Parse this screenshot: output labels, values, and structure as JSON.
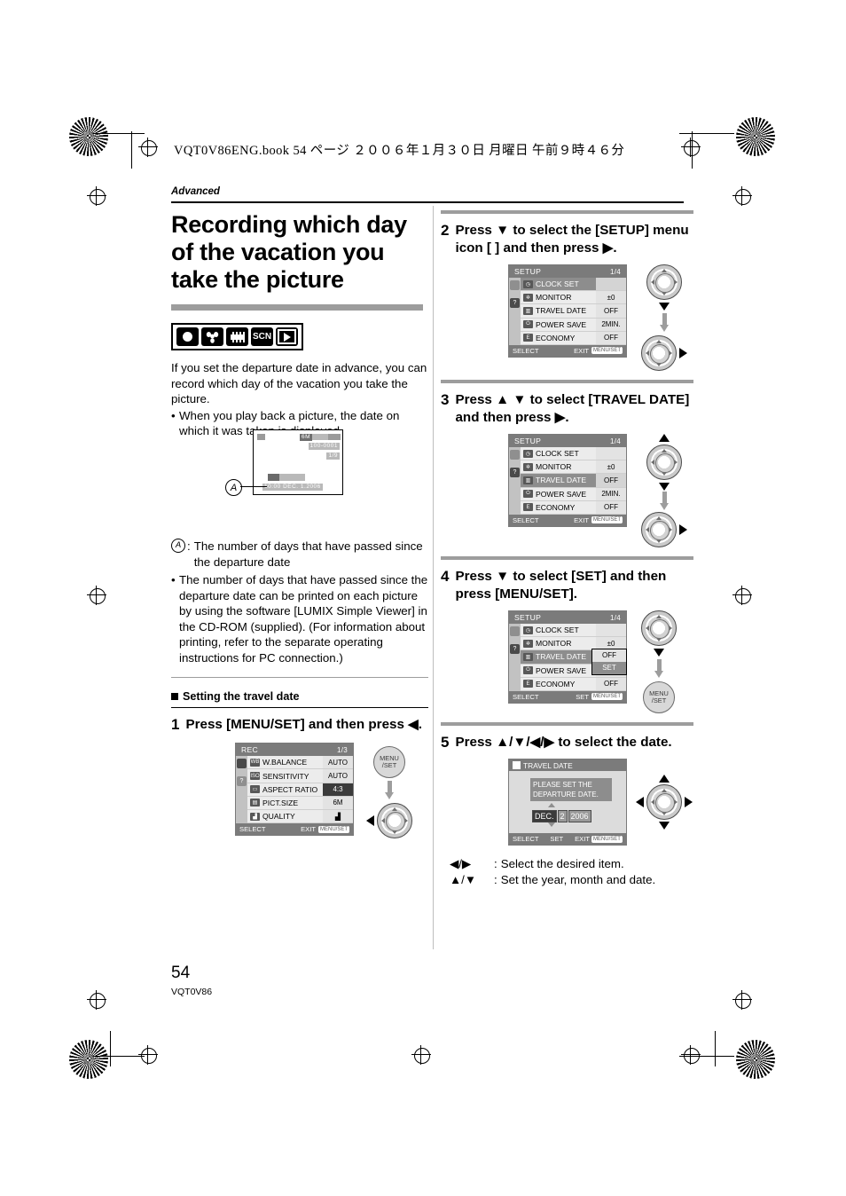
{
  "header": {
    "filename_line": "VQT0V86ENG.book   54 ページ   ２００６年１月３０日   月曜日   午前９時４６分",
    "running_head": "Advanced"
  },
  "title": "Recording which day of the vacation you take the picture",
  "mode_icons": [
    {
      "name": "camera-mode-icon",
      "label": ""
    },
    {
      "name": "macro-mode-icon",
      "label": ""
    },
    {
      "name": "motion-picture-mode-icon",
      "label": ""
    },
    {
      "name": "scene-mode-icon",
      "label": "SCN"
    },
    {
      "name": "playback-mode-icon",
      "label": ""
    }
  ],
  "intro": {
    "paragraph": "If you set the departure date in advance, you can record which day of the vacation you take the picture.",
    "bullet": "When you play back a picture, the date on which it was taken is displayed."
  },
  "preview_lcd": {
    "callout": "A",
    "pict_size": "6M",
    "battery": "",
    "file_number": "100-0001",
    "frame_counter": "1/9",
    "elapsed_badge": "",
    "datetime": "10:00  DEC. 1.2006"
  },
  "notes": {
    "callout_a": "The number of days that have passed since the departure date",
    "bullet": "The number of days that have passed since the departure date can be printed on each picture by using the software [LUMIX Simple Viewer] in the CD-ROM (supplied). (For information about printing, refer to the separate operating instructions for PC connection.)"
  },
  "section_heading": "Setting the travel date",
  "steps": [
    {
      "num": "1",
      "text": "Press [MENU/SET] and then press ◀."
    },
    {
      "num": "2",
      "text": "Press ▼ to select the [SETUP] menu icon [ ] and then press ▶."
    },
    {
      "num": "3",
      "text": "Press ▲ ▼ to select [TRAVEL DATE] and then press ▶."
    },
    {
      "num": "4",
      "text": "Press ▼ to select [SET] and then press [MENU/SET]."
    },
    {
      "num": "5",
      "text": "Press ▲/▼/◀/▶ to select the date."
    }
  ],
  "rec_menu": {
    "title": "REC",
    "page": "1/3",
    "rows": [
      {
        "icon": "WB",
        "label": "W.BALANCE",
        "value": "AUTO"
      },
      {
        "icon": "ISO",
        "label": "SENSITIVITY",
        "value": "AUTO"
      },
      {
        "icon": "AR",
        "label": "ASPECT RATIO",
        "value": "4:3"
      },
      {
        "icon": "PS",
        "label": "PICT.SIZE",
        "value": "6M"
      },
      {
        "icon": "Q",
        "label": "QUALITY",
        "value": ""
      }
    ],
    "footer_left": "SELECT",
    "footer_right": "EXIT",
    "footer_badge": "MENU/SET"
  },
  "setup_menu_step2": {
    "title": "SETUP",
    "page": "1/4",
    "rows": [
      {
        "label": "CLOCK SET",
        "value": "",
        "selected": true
      },
      {
        "label": "MONITOR",
        "value": "±0",
        "selected": false
      },
      {
        "label": "TRAVEL DATE",
        "value": "OFF",
        "selected": false
      },
      {
        "label": "POWER SAVE",
        "value": "2MIN.",
        "selected": false
      },
      {
        "label": "ECONOMY",
        "value": "OFF",
        "selected": false
      }
    ],
    "footer_left": "SELECT",
    "footer_right": "EXIT",
    "footer_badge": "MENU/SET"
  },
  "setup_menu_step3": {
    "title": "SETUP",
    "page": "1/4",
    "rows": [
      {
        "label": "CLOCK SET",
        "value": "",
        "selected": false
      },
      {
        "label": "MONITOR",
        "value": "±0",
        "selected": false
      },
      {
        "label": "TRAVEL DATE",
        "value": "OFF",
        "selected": true
      },
      {
        "label": "POWER SAVE",
        "value": "2MIN.",
        "selected": false
      },
      {
        "label": "ECONOMY",
        "value": "OFF",
        "selected": false
      }
    ],
    "footer_left": "SELECT",
    "footer_right": "EXIT",
    "footer_badge": "MENU/SET"
  },
  "setup_menu_step4": {
    "title": "SETUP",
    "page": "1/4",
    "rows": [
      {
        "label": "CLOCK SET",
        "value": "",
        "selected": false
      },
      {
        "label": "MONITOR",
        "value": "±0",
        "selected": false
      },
      {
        "label": "TRAVEL DATE",
        "value": "",
        "selected": true
      },
      {
        "label": "POWER SAVE",
        "value": "",
        "selected": false
      },
      {
        "label": "ECONOMY",
        "value": "OFF",
        "selected": false
      }
    ],
    "popup": {
      "off": "OFF",
      "set": "SET"
    },
    "footer_left": "SELECT",
    "footer_mid": "SET",
    "footer_badge": "MENU/SET"
  },
  "travel_date_lcd": {
    "title": "TRAVEL DATE",
    "message": "PLEASE SET THE DEPARTURE DATE.",
    "month": "DEC.",
    "day": "2",
    "year": "2006",
    "footer_left": "SELECT",
    "footer_mid": "SET",
    "footer_right": "EXIT",
    "footer_badge": "MENU/SET"
  },
  "key_legend": [
    {
      "keys": "◀/▶",
      "desc": "Select the desired item."
    },
    {
      "keys": "▲/▼",
      "desc": "Set the year, month and date."
    }
  ],
  "menu_set_button": {
    "line1": "MENU",
    "line2": "/SET"
  },
  "footer": {
    "page_number": "54",
    "doc_code": "VQT0V86"
  }
}
